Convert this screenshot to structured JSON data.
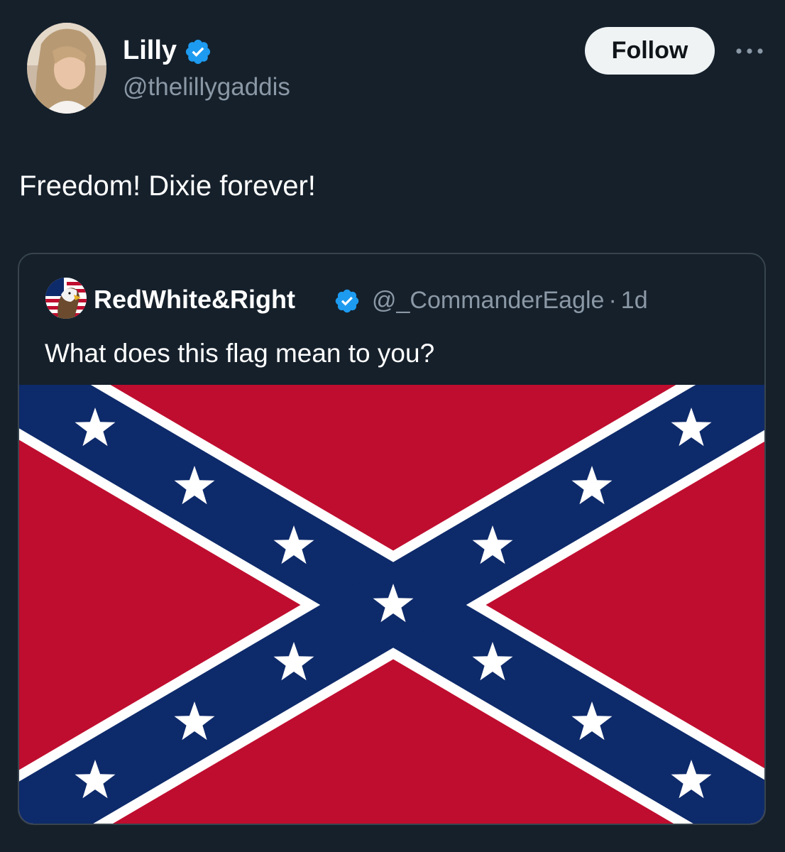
{
  "tweet": {
    "author_name": "Lilly",
    "author_handle": "@thelillygaddis",
    "verified": true,
    "text": "Freedom! Dixie forever!",
    "follow_label": "Follow",
    "more_icon": "more-horizontal-icon"
  },
  "quote": {
    "author_name": "RedWhite&Right",
    "author_handle": "@_CommanderEagle",
    "separator": "·",
    "time": "1d",
    "verified": true,
    "text": "What does this flag mean to you?",
    "media": "confederate-battle-flag-image"
  },
  "colors": {
    "background": "#15202b",
    "secondary_text": "#8b98a5",
    "verified_blue": "#1d9bf0",
    "follow_button_bg": "#eff3f4",
    "card_border": "#38444d",
    "flag_red": "#bf0d2f",
    "flag_blue": "#0d2a6a",
    "flag_white": "#ffffff"
  }
}
